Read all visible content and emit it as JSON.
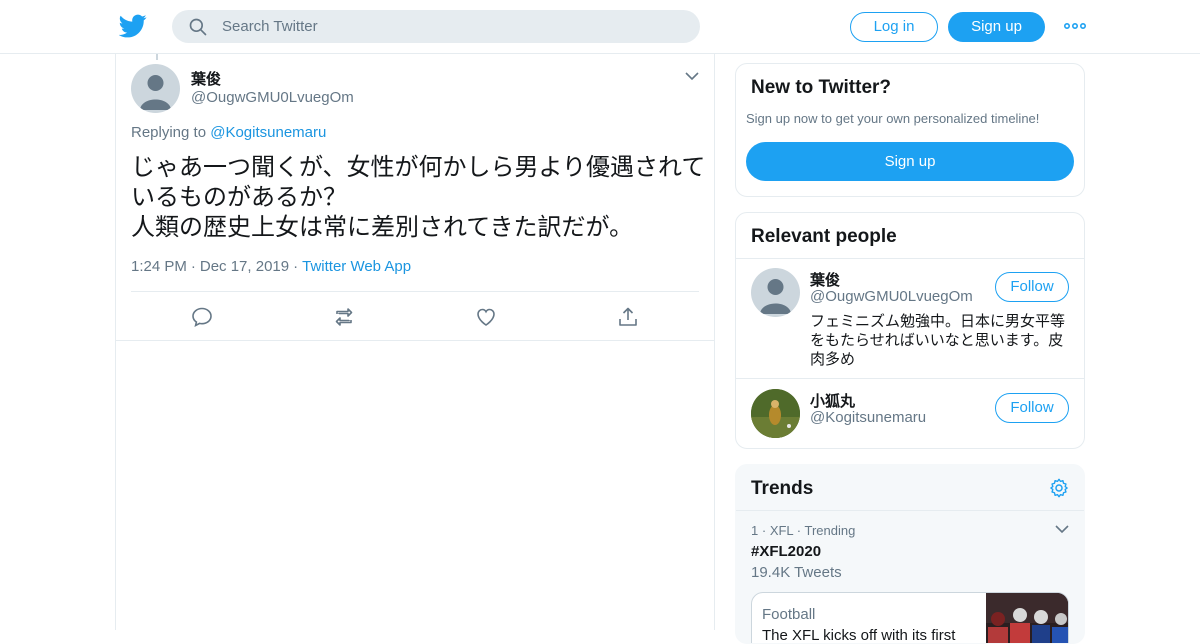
{
  "header": {
    "search_placeholder": "Search Twitter",
    "login_label": "Log in",
    "signup_label": "Sign up",
    "brand_color": "#1da1f2"
  },
  "tweet": {
    "author_name": "葉俊",
    "author_handle": "@OugwGMU0LvuegOm",
    "replying_prefix": "Replying to",
    "replying_to": "@Kogitsunemaru",
    "text": "じゃあ一つ聞くが、女性が何かしら男より優遇されているものがあるか？\n人類の歴史上女は常に差別されてきた訳だが。",
    "time": "1:24 PM",
    "date": "Dec 17, 2019",
    "app": "Twitter Web App",
    "sep": "·"
  },
  "new_to_twitter": {
    "title": "New to Twitter?",
    "subtitle": "Sign up now to get your own personalized timeline!",
    "button": "Sign up"
  },
  "relevant_people": {
    "title": "Relevant people",
    "people": [
      {
        "name": "葉俊",
        "handle": "@OugwGMU0LvuegOm",
        "bio": "フェミニズム勉強中。日本に男女平等をもたらせればいいなと思います。皮肉多め",
        "follow": "Follow"
      },
      {
        "name": "小狐丸",
        "handle": "@Kogitsunemaru",
        "follow": "Follow"
      }
    ]
  },
  "trends": {
    "title": "Trends",
    "items": [
      {
        "rank": "1",
        "category": "XFL",
        "status": "Trending",
        "name": "#XFL2020",
        "count": "19.4K Tweets",
        "card_category": "Football",
        "card_headline": "The XFL kicks off with its first"
      }
    ]
  }
}
